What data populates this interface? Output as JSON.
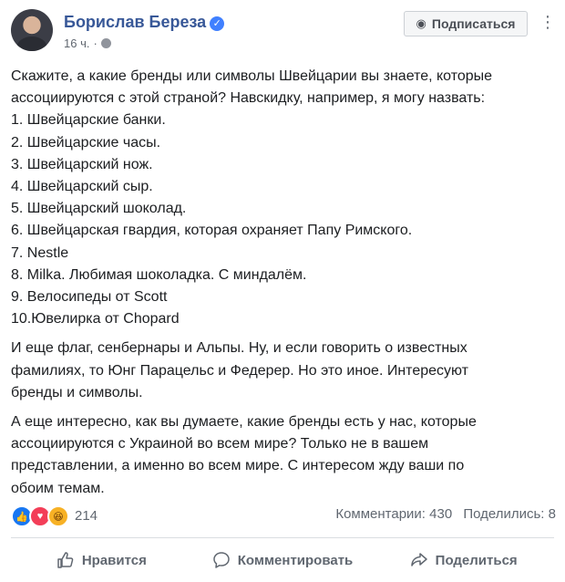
{
  "header": {
    "author": "Борислав Береза",
    "time": "16 ч.",
    "follow_label": "Подписаться"
  },
  "post": {
    "paragraphs": [
      {
        "lines": [
          "Скажите, а какие бренды или символы Швейцарии вы знаете, которые",
          "ассоциируются с этой страной? Навскидку, например, я могу назвать:",
          "1. Швейцарские банки.",
          "2. Швейцарские часы.",
          "3. Швейцарский нож.",
          "4. Швейцарский сыр.",
          "5. Швейцарский шоколад.",
          "6. Швейцарская гвардия, которая охраняет Папу Римского.",
          "7. Nestle",
          "8. Milka. Любимая шоколадка. С миндалём.",
          "9. Велосипеды от Scott",
          "10.Ювелирка от Chopard"
        ]
      },
      {
        "lines": [
          "И еще флаг, сенбернары и Альпы. Ну, и если говорить о известных",
          "фамилиях, то Юнг Парацельс и Федерер. Но это иное. Интересуют",
          "бренды и символы."
        ]
      },
      {
        "lines": [
          "А еще интересно, как вы думаете, какие бренды есть у нас, которые",
          "ассоциируются с Украиной во всем мире? Только не в вашем",
          "представлении, а именно во всем мире. С интересом жду ваши по",
          "обоим темам."
        ]
      }
    ]
  },
  "stats": {
    "reaction_count": "214",
    "comments": "Комментарии: 430",
    "shares": "Поделились: 8"
  },
  "actions": {
    "like": "Нравится",
    "comment": "Комментировать",
    "share": "Поделиться"
  },
  "icons": {
    "verified": "verified-badge-icon",
    "follow": "rss-icon",
    "more": "more-icon",
    "like": "thumbs-up-icon",
    "comment": "speech-bubble-icon",
    "share": "share-arrow-icon"
  },
  "colors": {
    "author": "#385898",
    "verified": "#4080ff",
    "like_reaction": "#1877f2",
    "love_reaction": "#f33e58",
    "haha_reaction": "#f7b125"
  }
}
